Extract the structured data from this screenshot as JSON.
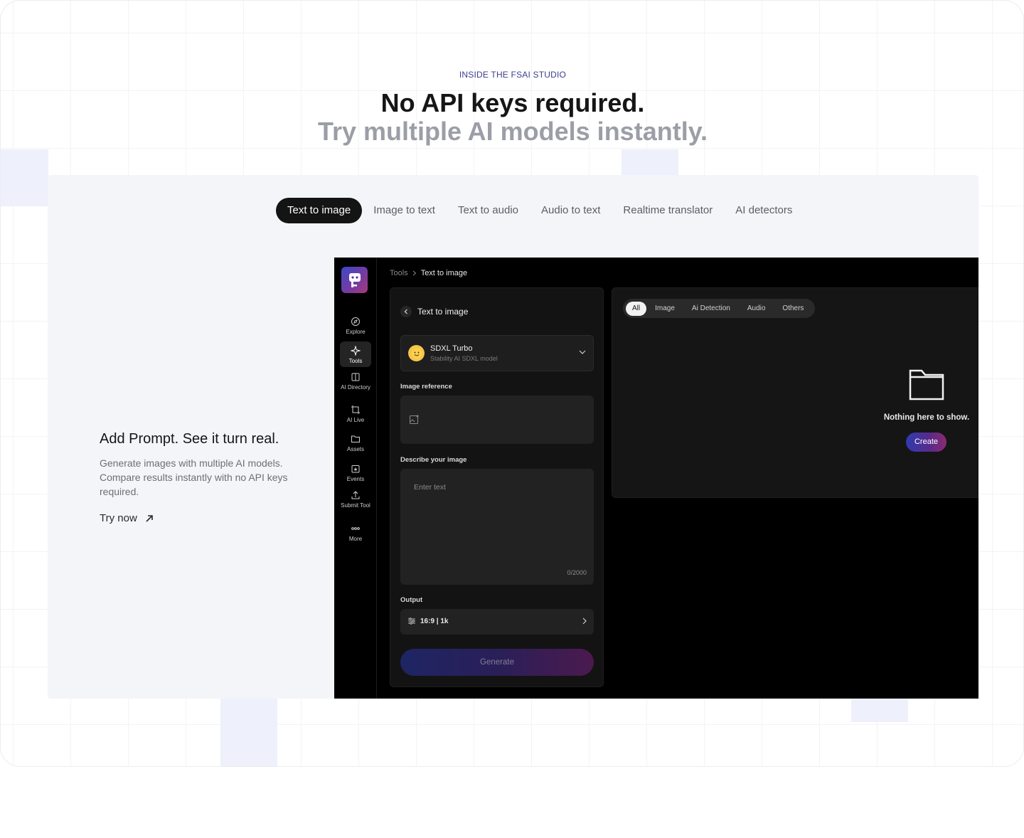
{
  "hero": {
    "eyebrow": "INSIDE THE FSAI STUDIO",
    "headline": "No API keys required.",
    "subheadline": "Try multiple AI models instantly."
  },
  "tabs": [
    {
      "label": "Text to image",
      "active": true
    },
    {
      "label": "Image to text",
      "active": false
    },
    {
      "label": "Text to audio",
      "active": false
    },
    {
      "label": "Audio to text",
      "active": false
    },
    {
      "label": "Realtime translator",
      "active": false
    },
    {
      "label": "AI detectors",
      "active": false
    }
  ],
  "feature": {
    "title": "Add Prompt. See it turn real.",
    "description": "Generate images with multiple AI models. Compare results instantly with no API keys required.",
    "cta": "Try now",
    "cta_icon": "arrow-up-right-icon"
  },
  "app": {
    "sidebar": [
      {
        "label": "Explore",
        "icon": "compass-icon"
      },
      {
        "label": "Tools",
        "icon": "sparkle-icon",
        "active": true
      },
      {
        "label": "AI Directory",
        "icon": "book-icon"
      },
      {
        "label": "AI Live",
        "icon": "crop-icon"
      },
      {
        "label": "Assets",
        "icon": "folder-icon"
      },
      {
        "label": "Events",
        "icon": "calendar-icon"
      },
      {
        "label": "Submit Tool",
        "icon": "upload-icon"
      },
      {
        "label": "More",
        "icon": "dots-icon"
      }
    ],
    "breadcrumb": {
      "root": "Tools",
      "current": "Text to image"
    },
    "form": {
      "title": "Text to image",
      "model_name": "SDXL Turbo",
      "model_sub": "Stability AI SDXL model",
      "image_reference_label": "Image reference",
      "describe_label": "Describe your image",
      "prompt_placeholder": "Enter text",
      "char_count": "0/2000",
      "output_label": "Output",
      "output_value": "16:9 | 1k",
      "generate_label": "Generate"
    },
    "results": {
      "filters": [
        {
          "label": "All",
          "active": true
        },
        {
          "label": "Image",
          "active": false
        },
        {
          "label": "Ai Detection",
          "active": false
        },
        {
          "label": "Audio",
          "active": false
        },
        {
          "label": "Others",
          "active": false
        }
      ],
      "empty_text": "Nothing here to show.",
      "create_label": "Create"
    }
  },
  "colors": {
    "accent_dark": "#141414",
    "eyebrow": "#3b3f8c",
    "subheadline": "#9b9ea6",
    "panel_bg": "#f4f5f9"
  }
}
